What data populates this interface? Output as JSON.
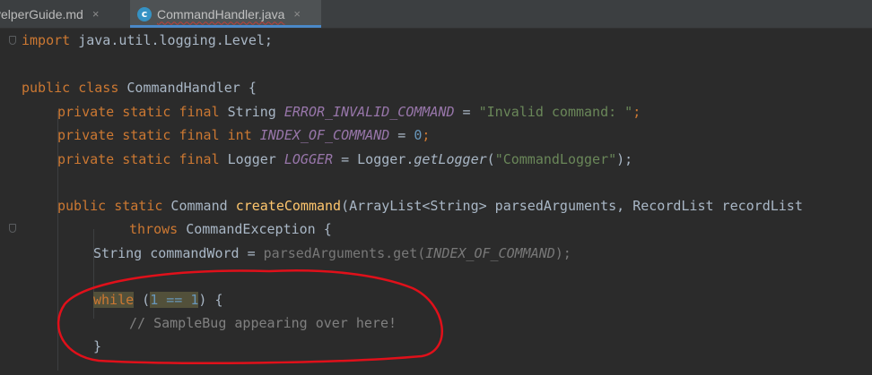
{
  "tabs": [
    {
      "label": "velperGuide.md",
      "close": "×"
    },
    {
      "label": "CommandHandler.java",
      "icon_letter": "c",
      "close": "×"
    }
  ],
  "code": {
    "l1": {
      "kw": "import",
      "rest": " java.util.logging.Level;"
    },
    "l3": {
      "kw1": "public",
      "kw2": "class",
      "rest": " CommandHandler {"
    },
    "l4": {
      "mods": "private static final",
      "type": " String ",
      "name": "ERROR_INVALID_COMMAND",
      "eq": " = ",
      "str": "\"Invalid command: \"",
      "end": ";"
    },
    "l5": {
      "mods": "private static final",
      "type": " int ",
      "name": "INDEX_OF_COMMAND",
      "eq": " = ",
      "num": "0",
      "end": ";"
    },
    "l6": {
      "mods": "private static final",
      "type": " Logger ",
      "name": "LOGGER",
      "eq": " = Logger.",
      "call": "getLogger",
      "open": "(",
      "str": "\"CommandLogger\"",
      "end": ");"
    },
    "l8": {
      "mods": "public static",
      "type": " Command ",
      "fn": "createCommand",
      "params": "(ArrayList<String> parsedArguments, RecordList recordList"
    },
    "l9": {
      "kw": "throws",
      "rest": " CommandException {"
    },
    "l10": {
      "a": "String commandWord = ",
      "unused": "parsedArguments.get(",
      "unused_const": "INDEX_OF_COMMAND",
      "unused_end": ");"
    },
    "l12": {
      "kw": "while",
      "open": " (",
      "cond": "1 == 1",
      "close": ") {"
    },
    "l13": {
      "comment": "// SampleBug appearing over here!"
    },
    "l14": {
      "brace": "}"
    }
  },
  "colors": {
    "background": "#2b2b2b",
    "keyword": "#cc7832",
    "constant": "#9876aa",
    "string": "#6a8759",
    "number": "#6897bb",
    "method": "#ffc66d",
    "annotation": "#e0101a"
  }
}
